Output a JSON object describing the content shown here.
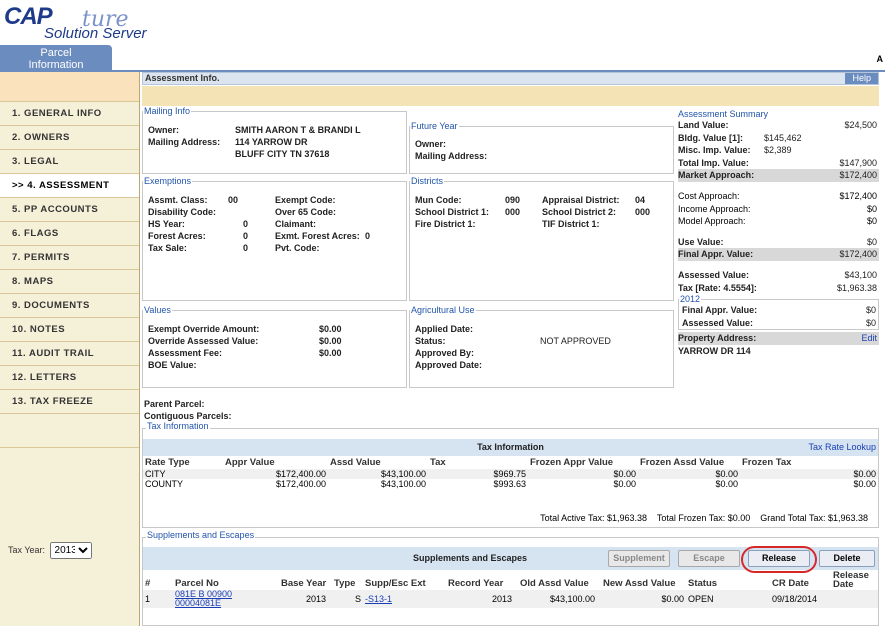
{
  "logo": {
    "cap": "CAP",
    "ture": "ture",
    "sub": "Solution Server"
  },
  "tab": {
    "label_line1": "Parcel",
    "label_line2": "Information",
    "right_letter": "A"
  },
  "nav": [
    "1. GENERAL INFO",
    "2. OWNERS",
    "3. LEGAL",
    ">> 4. ASSESSMENT",
    "5. PP ACCOUNTS",
    "6. FLAGS",
    "7. PERMITS",
    "8. MAPS",
    "9. DOCUMENTS",
    "10. NOTES",
    "11. AUDIT TRAIL",
    "12. LETTERS",
    "13. TAX FREEZE"
  ],
  "tax_year": {
    "label": "Tax Year:",
    "value": "2013"
  },
  "header": {
    "title": "Assessment Info.",
    "help": "Help"
  },
  "mailing": {
    "legend": "Mailing Info",
    "owner_label": "Owner:",
    "owner": "SMITH AARON T & BRANDI L",
    "address_label": "Mailing Address:",
    "address1": "114 YARROW DR",
    "address2": "BLUFF CITY TN 37618"
  },
  "future": {
    "legend": "Future Year",
    "owner_label": "Owner:",
    "address_label": "Mailing Address:"
  },
  "exemptions": {
    "legend": "Exemptions",
    "assmt_class_label": "Assmt. Class:",
    "assmt_class": "00",
    "exempt_code_label": "Exempt Code:",
    "disability_label": "Disability Code:",
    "over65_label": "Over 65 Code:",
    "hs_year_label": "HS Year:",
    "hs_year": "0",
    "claimant_label": "Claimant:",
    "forest_label": "Forest Acres:",
    "forest": "0",
    "exmt_forest_label": "Exmt. Forest Acres:",
    "exmt_forest": "0",
    "tax_sale_label": "Tax Sale:",
    "tax_sale": "0",
    "pvt_code_label": "Pvt. Code:"
  },
  "districts": {
    "legend": "Districts",
    "mun_label": "Mun Code:",
    "mun": "090",
    "appraisal_label": "Appraisal District:",
    "appraisal": "04",
    "school1_label": "School District 1:",
    "school1": "000",
    "school2_label": "School District 2:",
    "school2": "000",
    "fire_label": "Fire District 1:",
    "tif_label": "TIF District 1:"
  },
  "values": {
    "legend": "Values",
    "exempt_override_label": "Exempt Override Amount:",
    "exempt_override": "$0.00",
    "override_assessed_label": "Override Assessed Value:",
    "override_assessed": "$0.00",
    "assessment_fee_label": "Assessment Fee:",
    "assessment_fee": "$0.00",
    "boe_label": "BOE Value:"
  },
  "ag": {
    "legend": "Agricultural Use",
    "applied_label": "Applied Date:",
    "status_label": "Status:",
    "status": "NOT APPROVED",
    "approved_by_label": "Approved By:",
    "approved_date_label": "Approved Date:"
  },
  "parent_label": "Parent Parcel:",
  "contiguous_label": "Contiguous Parcels:",
  "summary": {
    "legend": "Assessment Summary",
    "land_label": "Land Value:",
    "land": "$24,500",
    "bldg_label": "Bldg. Value  [1]:",
    "bldg": "$145,462",
    "misc_label": "Misc. Imp. Value:",
    "misc": "$2,389",
    "total_imp_label": "Total Imp. Value:",
    "total_imp": "$147,900",
    "market_label": "Market Approach:",
    "market": "$172,400",
    "cost_label": "Cost Approach:",
    "cost": "$172,400",
    "income_label": "Income Approach:",
    "income": "$0",
    "model_label": "Model Approach:",
    "model": "$0",
    "use_label": "Use Value:",
    "use": "$0",
    "final_label": "Final Appr. Value:",
    "final": "$172,400",
    "assessed_label": "Assessed Value:",
    "assessed": "$43,100",
    "tax_label": "Tax  [Rate: 4.5554]:",
    "tax": "$1,963.38",
    "year2012_legend": "2012",
    "y2012_final_label": "Final Appr. Value:",
    "y2012_final": "$0",
    "y2012_assessed_label": "Assessed Value:",
    "y2012_assessed": "$0",
    "property_address_label": "Property Address:",
    "edit": "Edit",
    "property_address": "YARROW DR 114"
  },
  "tax_info": {
    "legend": "Tax Information",
    "title": "Tax Information",
    "lookup": "Tax Rate Lookup",
    "columns": [
      "Rate Type",
      "Appr Value",
      "Assd Value",
      "Tax",
      "Frozen Appr Value",
      "Frozen Assd Value",
      "Frozen Tax"
    ],
    "rows": [
      [
        "CITY",
        "$172,400.00",
        "$43,100.00",
        "$969.75",
        "$0.00",
        "$0.00",
        "$0.00"
      ],
      [
        "COUNTY",
        "$172,400.00",
        "$43,100.00",
        "$993.63",
        "$0.00",
        "$0.00",
        "$0.00"
      ]
    ],
    "total_active": "Total Active Tax: $1,963.38",
    "total_frozen": "Total Frozen Tax: $0.00",
    "grand_total": "Grand Total Tax: $1,963.38"
  },
  "supplements": {
    "legend": "Supplements and Escapes",
    "title": "Supplements and Escapes",
    "btn_supplement": "Supplement",
    "btn_escape": "Escape",
    "btn_release": "Release",
    "btn_delete": "Delete",
    "columns": [
      "#",
      "Parcel No",
      "Base Year",
      "Type",
      "Supp/Esc Ext",
      "Record Year",
      "Old Assd Value",
      "New Assd Value",
      "Status",
      "CR Date",
      "Release Date"
    ],
    "row": {
      "num": "1",
      "parcel_line1": "081E B 00900",
      "parcel_line2": "00004081E",
      "base_year": "2013",
      "type": "S",
      "ext": "-S13-1",
      "record_year": "2013",
      "old_assd": "$43,100.00",
      "new_assd": "$0.00",
      "status": "OPEN",
      "cr_date": "09/18/2014",
      "release_date": ""
    }
  },
  "colors": {
    "accent": "#6a8cbe",
    "link": "#1a3fb5",
    "highlight": "#d62828",
    "tan": "#f4e4b5"
  }
}
